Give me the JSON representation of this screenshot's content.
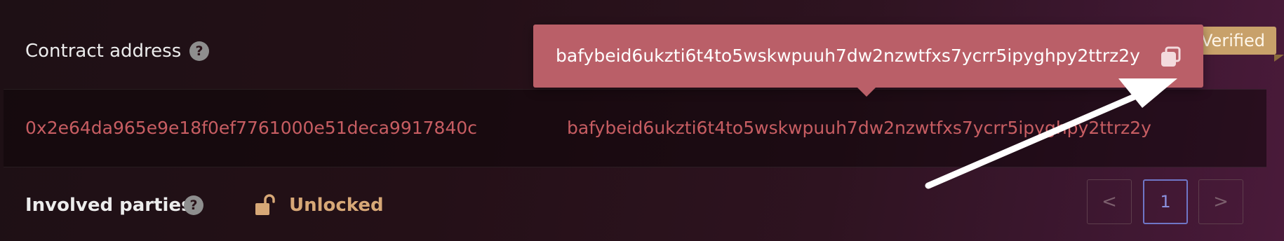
{
  "contract": {
    "label": "Contract address",
    "help_icon": "?",
    "verified_badge": "Verified"
  },
  "addresses": {
    "contract_address": "0x2e64da965e9e18f0ef7761000e51deca9917840c",
    "ipfs_hash": "bafybeid6ukzti6t4to5wskwpuuh7dw2nzwtfxs7ycrr5ipyghpy2ttrz2y"
  },
  "tooltip": {
    "text": "bafybeid6ukzti6t4to5wskwpuuh7dw2nzwtfxs7ycrr5ipyghpy2ttrz2y",
    "icon": "copy-icon"
  },
  "parties": {
    "label": "Involved parties",
    "help_icon": "?",
    "lock_icon": "unlocked-padlock-icon",
    "lock_status": "Unlocked"
  },
  "pagination": {
    "prev_label": "<",
    "current_page": "1",
    "next_label": ">"
  },
  "colors": {
    "accent_address": "#c75d62",
    "tooltip_bg": "#ba5f68",
    "badge_bg": "#c8a16a",
    "unlocked": "#d7a877",
    "active_page": "#6f76c6"
  },
  "annotation": {
    "arrow_icon": "white-arrow-pointing-to-copy-icon"
  }
}
